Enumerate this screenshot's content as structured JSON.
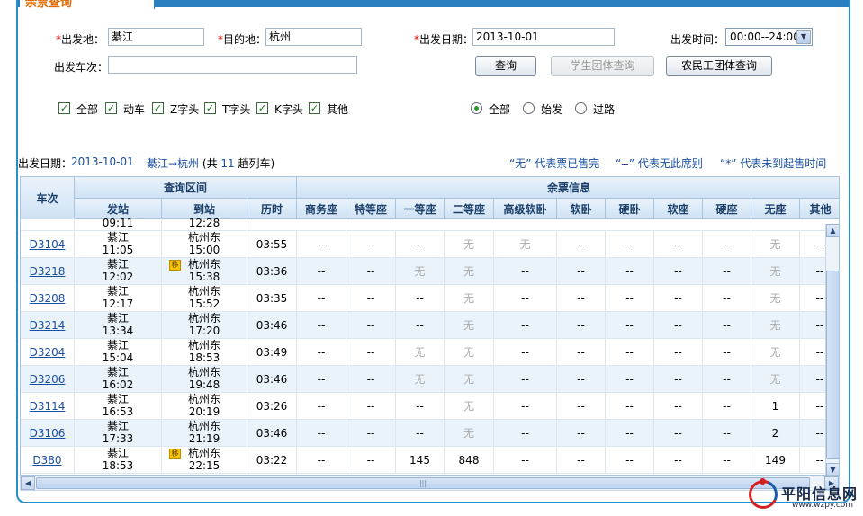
{
  "tab_title": "余票查询",
  "form": {
    "from_label": "出发地：",
    "from_value": "綦江",
    "to_label": "目的地：",
    "to_value": "杭州",
    "date_label": "出发日期：",
    "date_value": "2013-10-01",
    "time_label": "出发时间：",
    "time_value": "00:00--24:00",
    "train_no_label": "出发车次：",
    "train_no_value": "",
    "query_btn": "查询",
    "student_btn": "学生团体查询",
    "worker_btn": "农民工团体查询",
    "types": [
      {
        "label": "全部",
        "checked": true
      },
      {
        "label": "动车",
        "checked": true
      },
      {
        "label": "Z字头",
        "checked": true
      },
      {
        "label": "T字头",
        "checked": true
      },
      {
        "label": "K字头",
        "checked": true
      },
      {
        "label": "其他",
        "checked": true
      }
    ],
    "station_options": [
      {
        "label": "全部",
        "selected": true
      },
      {
        "label": "始发",
        "selected": false
      },
      {
        "label": "过路",
        "selected": false
      }
    ]
  },
  "summary": {
    "date_label": "出发日期：",
    "date_value": "2013-10-01",
    "route": "綦江→杭州",
    "count_prefix": "(共",
    "count": "11",
    "count_suffix": "趟列车)",
    "legend_none": "“无” 代表票已售完",
    "legend_dash": "“--” 代表无此席别",
    "legend_star": "“*” 代表未到起售时间"
  },
  "table": {
    "group_headers": {
      "train": "车次",
      "range": "查询区间",
      "tickets": "余票信息"
    },
    "headers": [
      "发站",
      "到站",
      "历时",
      "商务座",
      "特等座",
      "一等座",
      "二等座",
      "高级软卧",
      "软卧",
      "硬卧",
      "软座",
      "硬座",
      "无座",
      "其他"
    ],
    "partial_row": {
      "dep_time": "09:11",
      "arr_time": "12:28"
    },
    "rows": [
      {
        "train": "D3104",
        "from": "綦江",
        "dep": "11:05",
        "to": "杭州东",
        "arr": "15:00",
        "badge": false,
        "dur": "03:55",
        "seats": [
          "--",
          "--",
          "--",
          "无",
          "无",
          "--",
          "--",
          "--",
          "--",
          "无",
          "--"
        ]
      },
      {
        "train": "D3218",
        "from": "綦江",
        "dep": "12:02",
        "to": "杭州东",
        "arr": "15:38",
        "badge": true,
        "dur": "03:36",
        "seats": [
          "--",
          "--",
          "无",
          "无",
          "--",
          "--",
          "--",
          "--",
          "--",
          "无",
          "--"
        ]
      },
      {
        "train": "D3208",
        "from": "綦江",
        "dep": "12:17",
        "to": "杭州东",
        "arr": "15:52",
        "badge": false,
        "dur": "03:35",
        "seats": [
          "--",
          "--",
          "--",
          "无",
          "--",
          "--",
          "--",
          "--",
          "--",
          "无",
          "--"
        ]
      },
      {
        "train": "D3214",
        "from": "綦江",
        "dep": "13:34",
        "to": "杭州东",
        "arr": "17:20",
        "badge": false,
        "dur": "03:46",
        "seats": [
          "--",
          "--",
          "--",
          "无",
          "--",
          "--",
          "--",
          "--",
          "--",
          "无",
          "--"
        ]
      },
      {
        "train": "D3204",
        "from": "綦江",
        "dep": "15:04",
        "to": "杭州东",
        "arr": "18:53",
        "badge": false,
        "dur": "03:49",
        "seats": [
          "--",
          "--",
          "无",
          "无",
          "--",
          "--",
          "--",
          "--",
          "--",
          "无",
          "--"
        ]
      },
      {
        "train": "D3206",
        "from": "綦江",
        "dep": "16:02",
        "to": "杭州东",
        "arr": "19:48",
        "badge": false,
        "dur": "03:46",
        "seats": [
          "--",
          "--",
          "无",
          "无",
          "--",
          "--",
          "--",
          "--",
          "--",
          "无",
          "--"
        ]
      },
      {
        "train": "D3114",
        "from": "綦江",
        "dep": "16:53",
        "to": "杭州东",
        "arr": "20:19",
        "badge": false,
        "dur": "03:26",
        "seats": [
          "--",
          "--",
          "--",
          "无",
          "--",
          "--",
          "--",
          "--",
          "--",
          "1",
          "--"
        ]
      },
      {
        "train": "D3106",
        "from": "綦江",
        "dep": "17:33",
        "to": "杭州东",
        "arr": "21:19",
        "badge": false,
        "dur": "03:46",
        "seats": [
          "--",
          "--",
          "--",
          "无",
          "--",
          "--",
          "--",
          "--",
          "--",
          "2",
          "--"
        ]
      },
      {
        "train": "D380",
        "from": "綦江",
        "dep": "18:53",
        "to": "杭州东",
        "arr": "22:15",
        "badge": true,
        "dur": "03:22",
        "seats": [
          "--",
          "--",
          "145",
          "848",
          "--",
          "--",
          "--",
          "--",
          "--",
          "149",
          "--"
        ]
      }
    ]
  },
  "badge_text": "移",
  "watermark": {
    "name": "平阳信息网",
    "url": "www.wzpy.com"
  },
  "colors": {
    "accent": "#2a7fc0",
    "link": "#1a4fa0",
    "tab_title": "#e06a00",
    "required": "#d00000"
  }
}
